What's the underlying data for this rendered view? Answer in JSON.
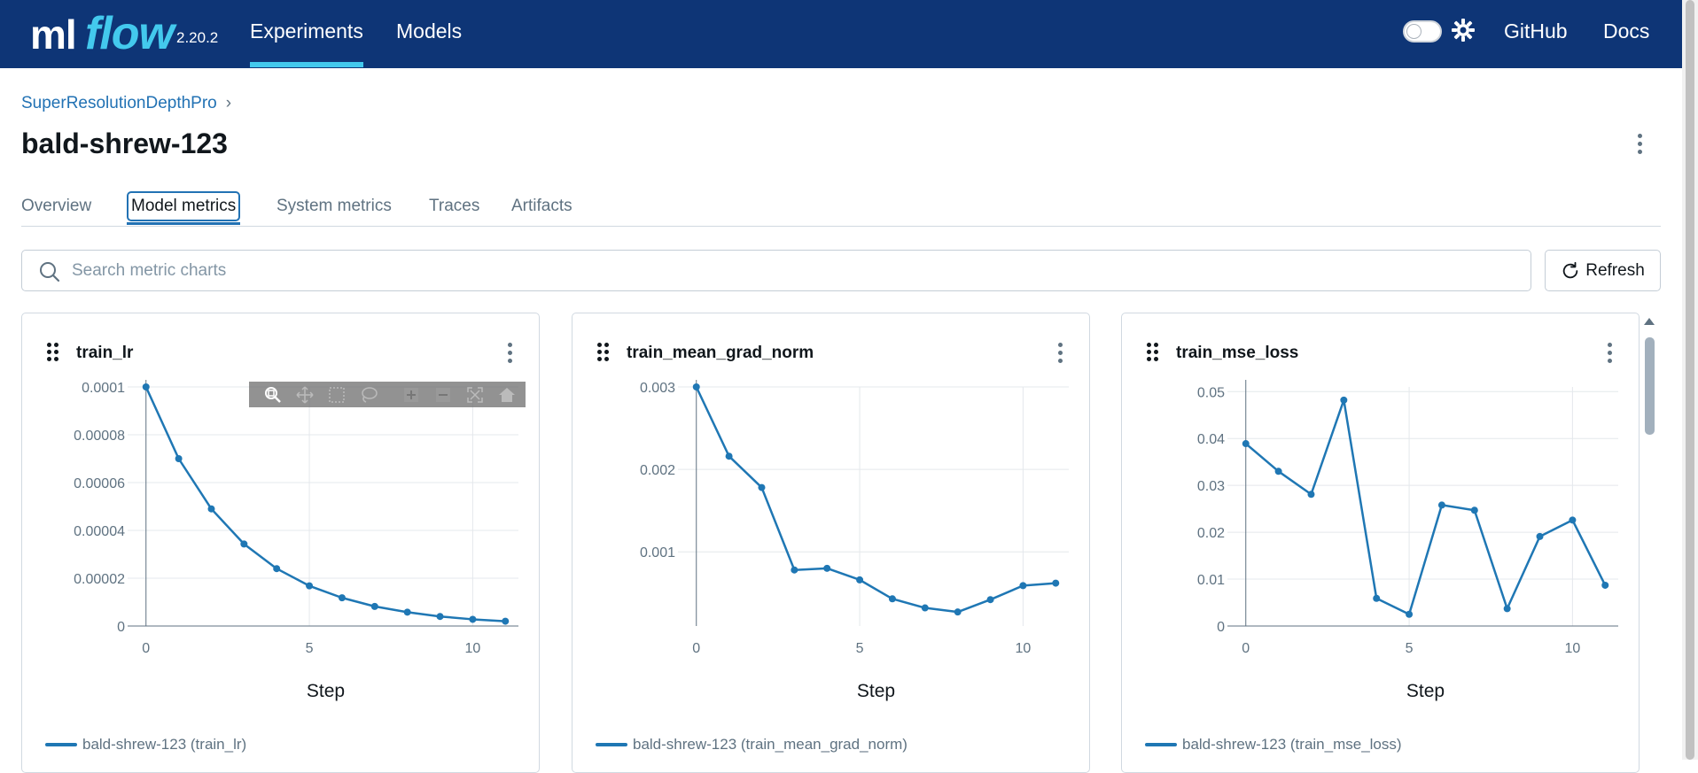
{
  "header": {
    "logo_ml": "ml",
    "logo_flow": "flow",
    "version": "2.20.2",
    "nav": [
      {
        "label": "Experiments",
        "active": true
      },
      {
        "label": "Models",
        "active": false
      }
    ],
    "github_label": "GitHub",
    "docs_label": "Docs",
    "dark_mode_on": false
  },
  "breadcrumb": {
    "experiment": "SuperResolutionDepthPro",
    "separator": "›"
  },
  "page_title": "bald-shrew-123",
  "tabs": [
    {
      "label": "Overview",
      "active": false
    },
    {
      "label": "Model metrics",
      "active": true
    },
    {
      "label": "System metrics",
      "active": false
    },
    {
      "label": "Traces",
      "active": false
    },
    {
      "label": "Artifacts",
      "active": false
    }
  ],
  "search": {
    "placeholder": "Search metric charts",
    "value": ""
  },
  "refresh_label": "Refresh",
  "colors": {
    "brand": "#0e3576",
    "accent": "#43c9ed",
    "link": "#2272b4",
    "series": "#1f77b4"
  },
  "icons": [
    "search-icon",
    "refresh-icon",
    "gear-icon",
    "drag-handle-icon",
    "kebab-menu-icon",
    "zoom-icon",
    "pan-icon",
    "box-select-icon",
    "lasso-select-icon",
    "zoom-in-icon",
    "zoom-out-icon",
    "autoscale-icon",
    "reset-axes-icon"
  ],
  "chart_data": [
    {
      "type": "line",
      "title": "train_lr",
      "xlabel": "Step",
      "ylabel": "",
      "x": [
        0,
        1,
        2,
        3,
        4,
        5,
        6,
        7,
        8,
        9,
        10,
        11
      ],
      "series": [
        {
          "name": "bald-shrew-123 (train_lr)",
          "values": [
            0.0001,
            7e-05,
            4.9e-05,
            3.43e-05,
            2.4e-05,
            1.68e-05,
            1.18e-05,
            8.2e-06,
            5.8e-06,
            4e-06,
            2.8e-06,
            2e-06
          ]
        }
      ],
      "xlim": [
        -0.4,
        11.4
      ],
      "ylim": [
        0,
        0.0001
      ],
      "xticks": [
        0,
        5,
        10
      ],
      "yticks": [
        0,
        2e-05,
        4e-05,
        6e-05,
        8e-05,
        0.0001
      ],
      "ytick_labels": [
        "0",
        "0.00002",
        "0.00004",
        "0.00006",
        "0.00008",
        "0.0001"
      ],
      "grid": true,
      "legend": "bottom-left"
    },
    {
      "type": "line",
      "title": "train_mean_grad_norm",
      "xlabel": "Step",
      "ylabel": "",
      "x": [
        0,
        1,
        2,
        3,
        4,
        5,
        6,
        7,
        8,
        9,
        10,
        11
      ],
      "series": [
        {
          "name": "bald-shrew-123 (train_mean_grad_norm)",
          "values": [
            0.003,
            0.00216,
            0.00178,
            0.00078,
            0.0008,
            0.00066,
            0.00043,
            0.00032,
            0.00027,
            0.00042,
            0.00059,
            0.00062
          ]
        }
      ],
      "xlim": [
        -0.4,
        11.4
      ],
      "ylim": [
        0.0001,
        0.003
      ],
      "xticks": [
        0,
        5,
        10
      ],
      "yticks": [
        0.001,
        0.002,
        0.003
      ],
      "ytick_labels": [
        "0.001",
        "0.002",
        "0.003"
      ],
      "grid": true,
      "legend": "bottom-left"
    },
    {
      "type": "line",
      "title": "train_mse_loss",
      "xlabel": "Step",
      "ylabel": "",
      "x": [
        0,
        1,
        2,
        3,
        4,
        5,
        6,
        7,
        8,
        9,
        10,
        11
      ],
      "series": [
        {
          "name": "bald-shrew-123 (train_mse_loss)",
          "values": [
            0.0389,
            0.033,
            0.0281,
            0.0482,
            0.0059,
            0.0025,
            0.0258,
            0.0247,
            0.0037,
            0.0191,
            0.0226,
            0.0087
          ]
        }
      ],
      "xlim": [
        -0.4,
        11.4
      ],
      "ylim": [
        0,
        0.051
      ],
      "xticks": [
        0,
        5,
        10
      ],
      "yticks": [
        0,
        0.01,
        0.02,
        0.03,
        0.04,
        0.05
      ],
      "ytick_labels": [
        "0",
        "0.01",
        "0.02",
        "0.03",
        "0.04",
        "0.05"
      ],
      "grid": true,
      "legend": "bottom-left"
    }
  ]
}
